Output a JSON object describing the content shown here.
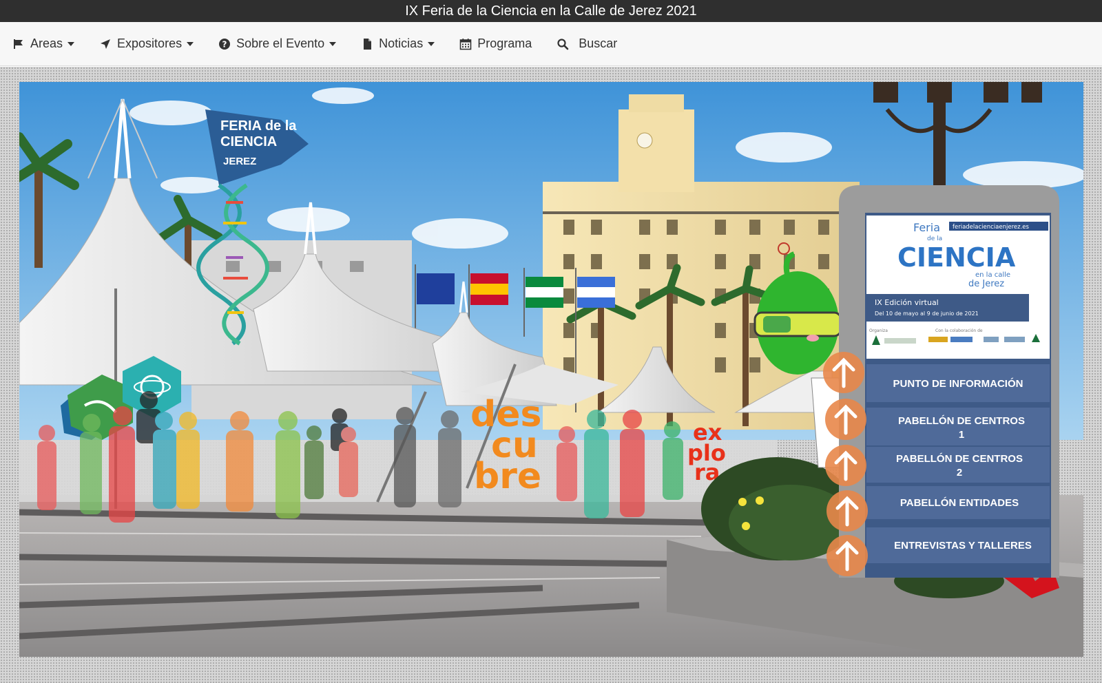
{
  "window": {
    "title": "IX Feria de la Ciencia en la Calle de Jerez 2021"
  },
  "nav": {
    "items": [
      {
        "label": "Areas",
        "icon": "flag-icon",
        "dropdown": true
      },
      {
        "label": "Expositores",
        "icon": "location-arrow-icon",
        "dropdown": true
      },
      {
        "label": "Sobre el Evento",
        "icon": "question-circle-icon",
        "dropdown": true
      },
      {
        "label": "Noticias",
        "icon": "file-icon",
        "dropdown": true
      },
      {
        "label": "Programa",
        "icon": "calendar-icon",
        "dropdown": false
      },
      {
        "label": "Buscar",
        "icon": "search-icon",
        "dropdown": false
      }
    ]
  },
  "scene": {
    "sign": {
      "line1": "FERIA de la",
      "line2": "CIENCIA",
      "line3": "JEREZ"
    },
    "letters": {
      "descubre": [
        "des",
        "cu",
        "bre"
      ],
      "explora": [
        "ex",
        "plo",
        "ra"
      ]
    },
    "panel": {
      "logo_feria": "Feria",
      "logo_dela": "de la",
      "logo_ciencia": "CIENCIA",
      "logo_enlacalle": "en la calle",
      "logo_dejerez": "de Jerez",
      "website": "feriadelacienciaenjerez.es",
      "edition": "IX Edición virtual",
      "dates": "Del 10 de mayo al 9 de junio de 2021",
      "organiza": "Organiza",
      "colaboracion": "Con la colaboración de",
      "buttons": [
        {
          "line1": "PUNTO DE INFORMACIÓN",
          "line2": ""
        },
        {
          "line1": "PABELLÓN DE CENTROS",
          "line2": "1"
        },
        {
          "line1": "PABELLÓN DE CENTROS",
          "line2": "2"
        },
        {
          "line1": "PABELLÓN ENTIDADES",
          "line2": ""
        },
        {
          "line1": "ENTREVISTAS Y TALLERES",
          "line2": ""
        }
      ]
    },
    "colors": {
      "sky": "#5aa7e0",
      "panel_button": "#4f6a99",
      "arrow_button": "#e8874a",
      "mascot": "#2fb52f",
      "letters": "#f28a1e"
    }
  }
}
